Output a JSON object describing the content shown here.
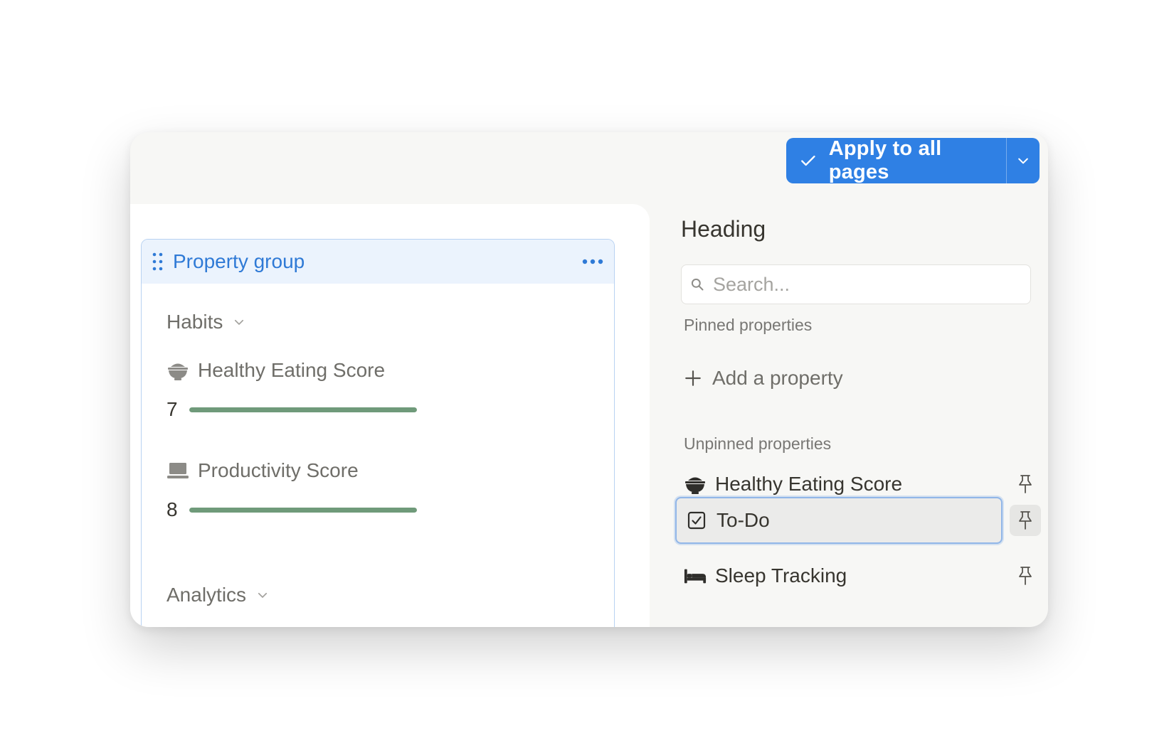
{
  "toolbar": {
    "apply_label": "Apply to all pages",
    "accent": "#2f80e4"
  },
  "property_group": {
    "title": "Property group",
    "sections": [
      {
        "label": "Habits",
        "properties": [
          {
            "icon": "bowl-icon",
            "label": "Healthy Eating Score",
            "value": "7",
            "progress": 1.0
          },
          {
            "icon": "laptop-icon",
            "label": "Productivity Score",
            "value": "8",
            "progress": 1.0
          }
        ]
      },
      {
        "label": "Analytics"
      }
    ]
  },
  "side_panel": {
    "heading": "Heading",
    "search": {
      "placeholder": "Search...",
      "value": ""
    },
    "pinned_label": "Pinned properties",
    "add_property_label": "Add a property",
    "unpinned_label": "Unpinned properties",
    "unpinned": [
      {
        "icon": "bowl-icon",
        "label": "Healthy Eating Score",
        "selected": false
      },
      {
        "icon": "checkbox-icon",
        "label": "To-Do",
        "selected": true
      },
      {
        "icon": "bed-icon",
        "label": "Sleep Tracking",
        "selected": false
      }
    ]
  }
}
